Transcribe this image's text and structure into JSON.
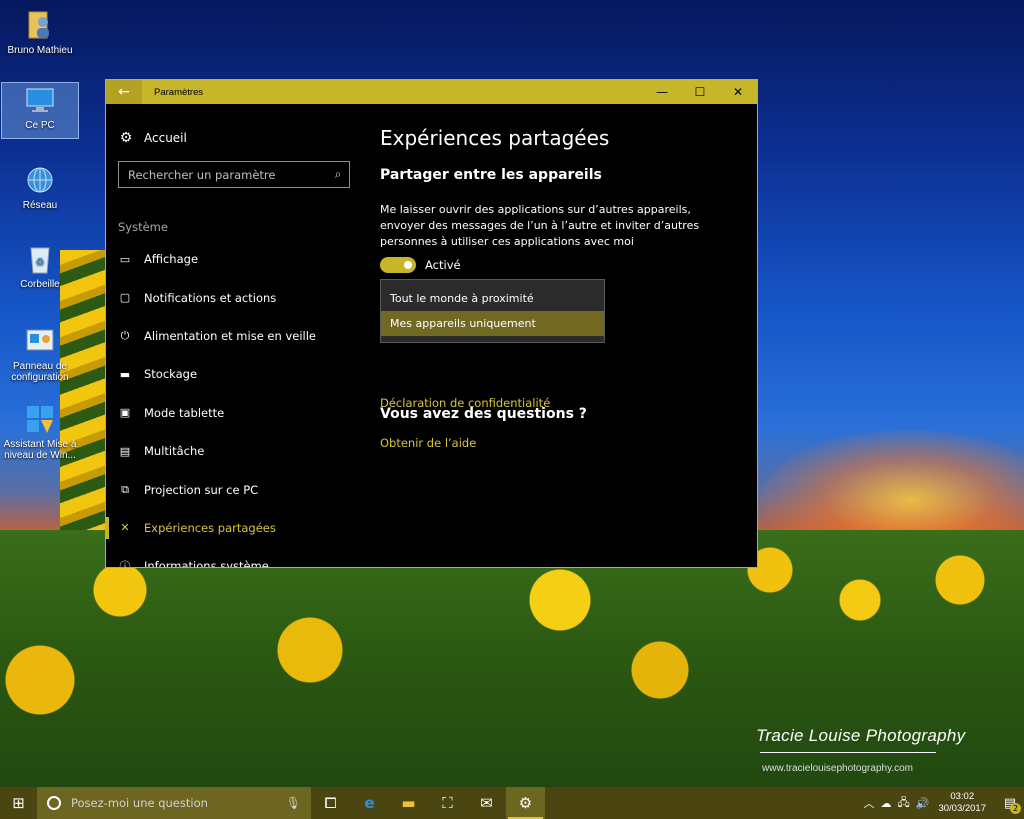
{
  "desktop": {
    "icons": [
      {
        "label": "Bruno Mathieu"
      },
      {
        "label": "Ce PC"
      },
      {
        "label": "Réseau"
      },
      {
        "label": "Corbeille"
      },
      {
        "label": "Panneau de configuration"
      },
      {
        "label": "Assistant Mise à niveau de Win..."
      }
    ],
    "watermark": "Tracie Louise Photography",
    "watermark_url": "www.tracielouisephotography.com"
  },
  "window": {
    "title": "Paramètres",
    "back_icon": "back-arrow-icon",
    "controls": {
      "minimize": "—",
      "maximize": "☐",
      "close": "✕"
    }
  },
  "sidebar": {
    "home_label": "Accueil",
    "search_placeholder": "Rechercher un paramètre",
    "section_label": "Système",
    "items": [
      {
        "label": "Affichage",
        "icon": "display-icon"
      },
      {
        "label": "Notifications et actions",
        "icon": "notification-icon"
      },
      {
        "label": "Alimentation et mise en veille",
        "icon": "power-icon"
      },
      {
        "label": "Stockage",
        "icon": "storage-icon"
      },
      {
        "label": "Mode tablette",
        "icon": "tablet-icon"
      },
      {
        "label": "Multitâche",
        "icon": "multitask-icon"
      },
      {
        "label": "Projection sur ce PC",
        "icon": "projection-icon"
      },
      {
        "label": "Expériences partagées",
        "icon": "shared-experiences-icon",
        "active": true
      },
      {
        "label": "Informations système",
        "icon": "info-icon"
      }
    ]
  },
  "content": {
    "title": "Expériences partagées",
    "subtitle": "Partager entre les appareils",
    "description": "Me laisser ouvrir des applications sur d’autres appareils, envoyer des messages de l’un à l’autre et inviter d’autres personnes à utiliser ces applications avec moi",
    "toggle_label": "Activé",
    "toggle_on": true,
    "dropdown_options": [
      "Tout le monde à proximité",
      "Mes appareils uniquement"
    ],
    "dropdown_selected": "Mes appareils uniquement",
    "privacy_link": "Déclaration de confidentialité",
    "questions_heading": "Vous avez des questions ?",
    "help_link": "Obtenir de l’aide"
  },
  "taskbar": {
    "search_placeholder": "Posez-moi une question",
    "clock_time": "03:02",
    "clock_date": "30/03/2017",
    "notification_count": "2",
    "accent": "#c7b52a"
  }
}
